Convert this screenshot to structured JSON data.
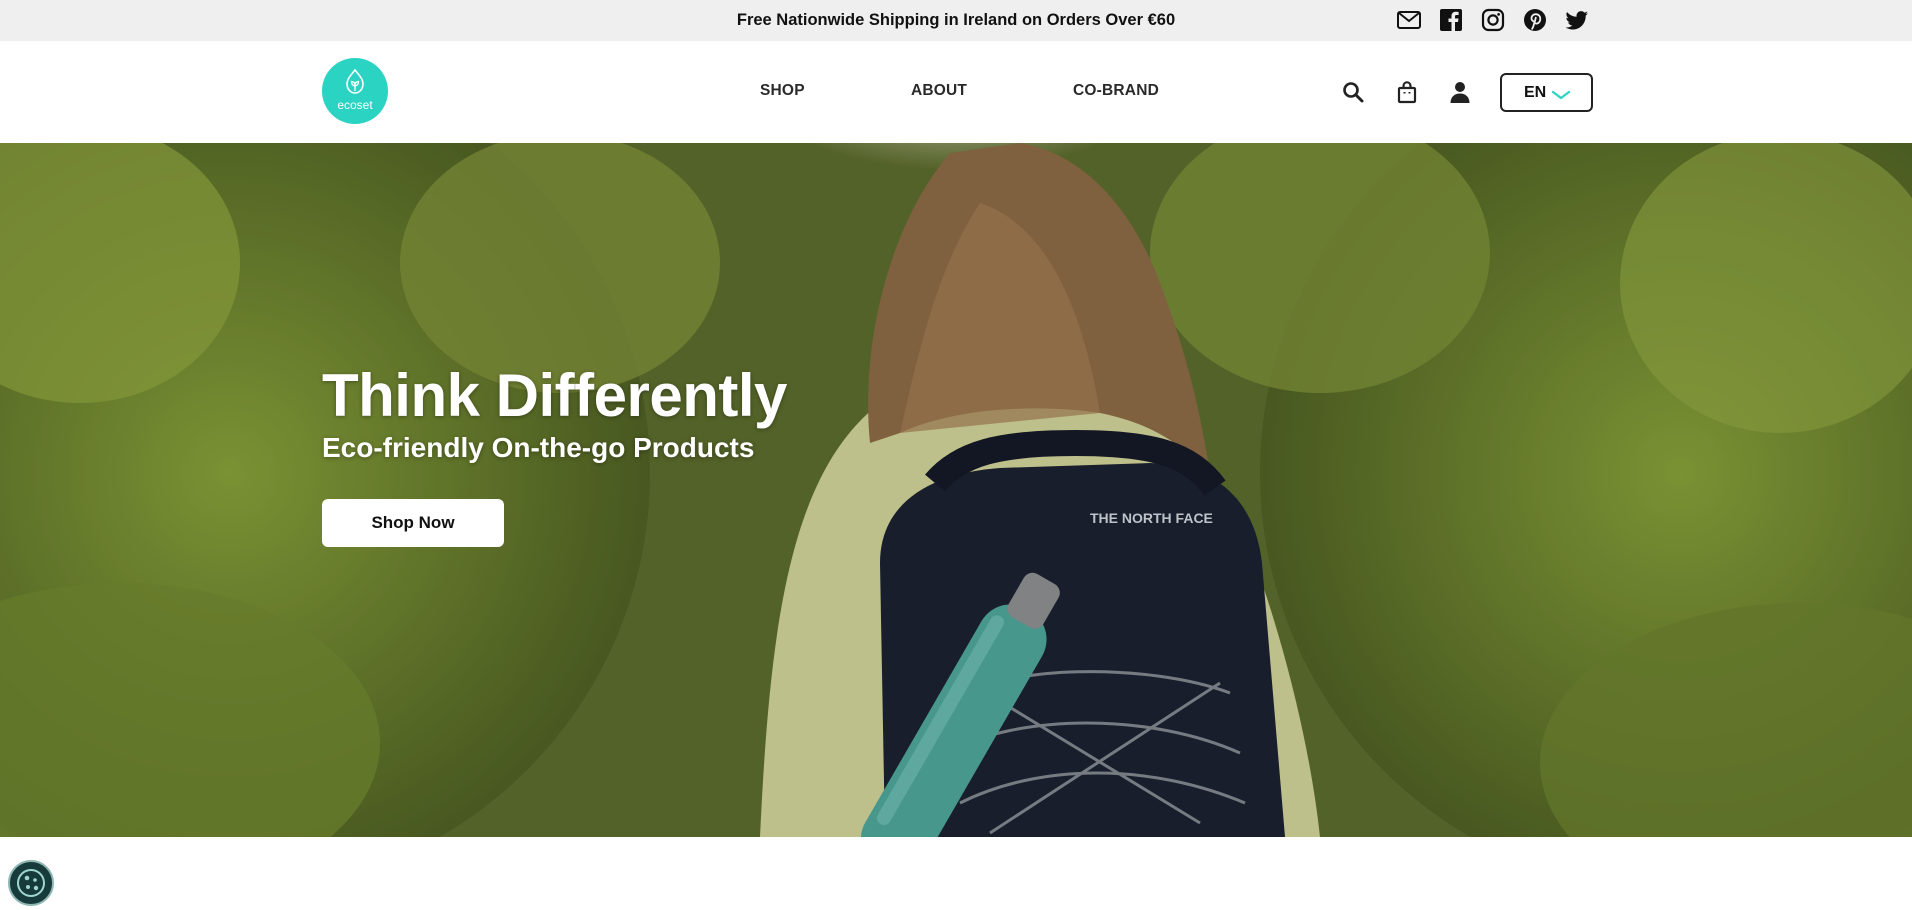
{
  "announcement": {
    "text": "Free Nationwide Shipping in Ireland on Orders Over €60"
  },
  "social_icons": [
    "mail-icon",
    "facebook-icon",
    "instagram-icon",
    "pinterest-icon",
    "twitter-icon"
  ],
  "brand": {
    "logo_text": "ecoset",
    "accent_color": "#2bd3c3"
  },
  "nav": {
    "items": [
      {
        "label": "SHOP"
      },
      {
        "label": "ABOUT"
      },
      {
        "label": "CO-BRAND"
      }
    ]
  },
  "header_icons": [
    "search-icon",
    "bag-icon",
    "account-icon"
  ],
  "language": {
    "selected": "EN"
  },
  "hero": {
    "title": "Think Differently",
    "subtitle": "Eco-friendly On-the-go Products",
    "cta_label": "Shop Now"
  },
  "cookie_widget": {
    "icon": "cookie-icon"
  }
}
